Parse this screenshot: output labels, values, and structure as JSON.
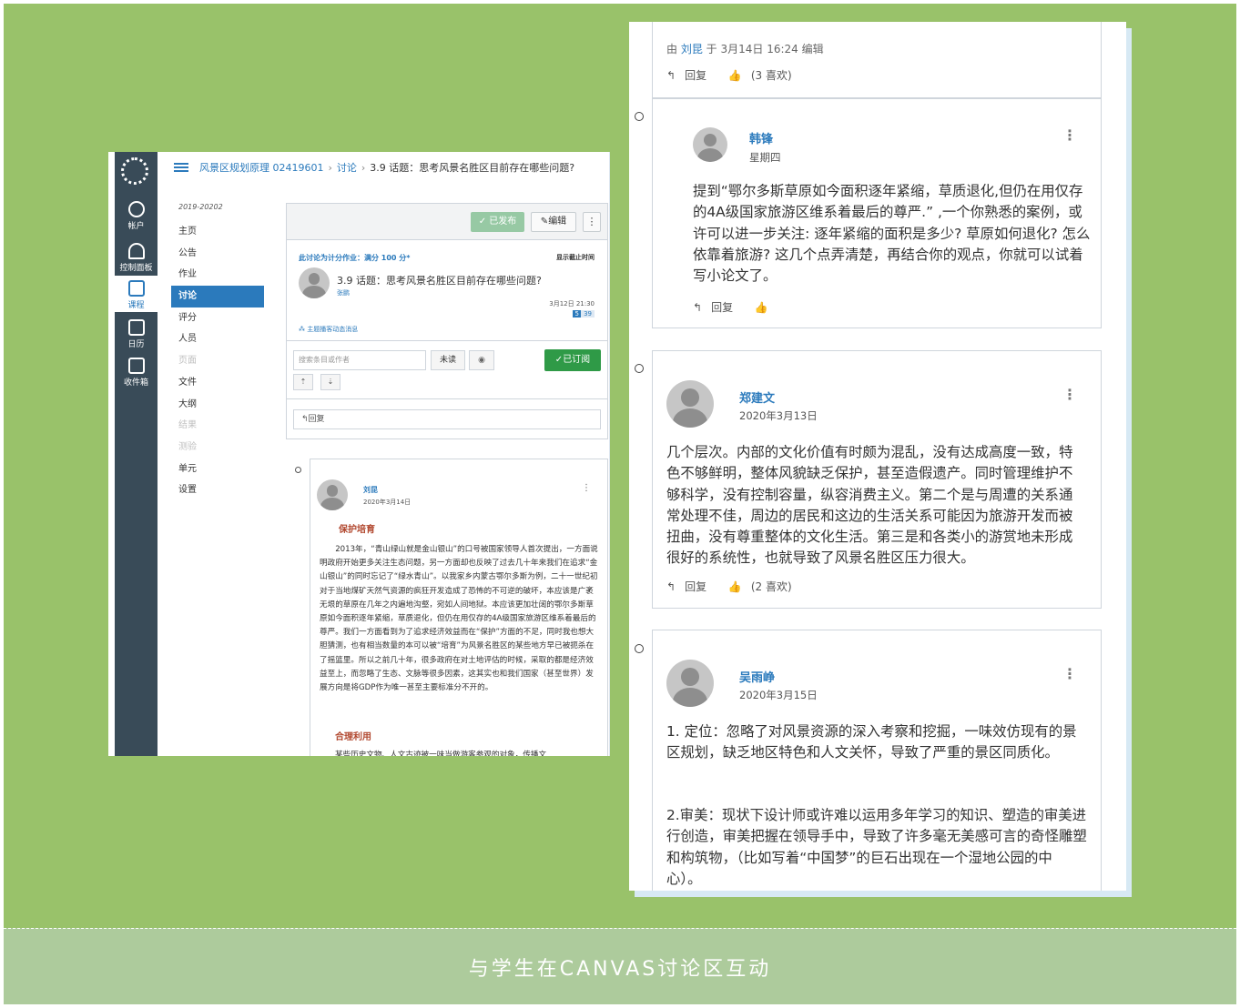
{
  "caption": "与学生在CANVAS讨论区互动",
  "left": {
    "global_nav": [
      {
        "label": "帐户",
        "icon": "account-icon"
      },
      {
        "label": "控制面板",
        "icon": "dashboard-icon"
      },
      {
        "label": "课程",
        "icon": "courses-icon"
      },
      {
        "label": "日历",
        "icon": "calendar-icon"
      },
      {
        "label": "收件箱",
        "icon": "inbox-icon"
      }
    ],
    "breadcrumb": {
      "course": "风景区规划原理 02419601",
      "section": "讨论",
      "current": "3.9 话题：思考风景名胜区目前存在哪些问题?"
    },
    "term": "2019-20202",
    "course_nav": [
      "主页",
      "公告",
      "作业",
      "讨论",
      "评分",
      "人员",
      "页面",
      "文件",
      "大纲",
      "结果",
      "测验",
      "单元",
      "设置"
    ],
    "topic": {
      "published_label": "已发布",
      "edit_label": "编辑",
      "kebab": "⋮",
      "graded_label": "此讨论为计分作业：满分 100 分*",
      "due_label": "显示截止时间",
      "title": "3.9 话题：思考风景名胜区目前存在哪些问题?",
      "author": "张鹏",
      "date": "3月12日 21:30",
      "unread_count": "5",
      "total_count": "39",
      "subscribe_hint": "主题播客动态消息"
    },
    "toolbar": {
      "search_placeholder": "搜索条目或作者",
      "unread_label": "未读",
      "eye": "◉",
      "subscribed_label": "已订阅",
      "expand": "⇡",
      "collapse": "⇣",
      "reply_label": "回复"
    },
    "entry": {
      "author": "刘昆",
      "date": "2020年3月14日",
      "kebab": "⋮",
      "heading1": "保护培育",
      "body": "2013年，“青山绿山就是金山银山”的口号被国家领导人首次提出，一方面说明政府开始更多关注生态问题，另一方面却也反映了过去几十年来我们在追求“金山银山”的同时忘记了“绿水青山”。以我家乡内蒙古鄂尔多斯为例，二十一世纪初对于当地煤矿天然气资源的疯狂开发造成了恐怖的不可逆的破坏，本应该是广袤无垠的草原在几年之内遍地沟壑，宛如人间地狱。本应该更加壮阔的鄂尔多斯草原如今面积逐年紧缩，草质退化，但仍在用仅存的4A级国家旅游区维系着最后的尊严。我们一方面看到为了追求经济效益而在“保护”方面的不足，同时我也想大胆猜测，也有相当数量的本可以被“培育”为风景名胜区的某些地方早已被扼杀在了摇篮里。所以之前几十年，很多政府在对土地评估的时候，采取的都是经济效益至上，而忽略了生态、文脉等很多因素，这其实也和我们国家（甚至世界）发展方向是将GDP作为唯一甚至主要标准分不开的。",
      "heading2": "合理利用",
      "tail": "某些历史文物、人文古迹被一味当做游客参观的对象，传播文"
    }
  },
  "right": {
    "top": {
      "edited_prefix": "由 ",
      "edited_by": "刘昆",
      "edited_suffix": " 于 3月14日 16:24 编辑",
      "reply": "回复",
      "likes": "(3 喜欢)"
    },
    "posts": [
      {
        "author": "韩锋",
        "date": "星期四",
        "text": "提到“鄂尔多斯草原如今面积逐年紧缩，草质退化,但仍在用仅存的4A级国家旅游区维系着最后的尊严.” ,一个你熟悉的案例，或许可以进一步关注: 逐年紧缩的面积是多少? 草原如何退化? 怎么依靠着旅游? 这几个点弄清楚，再结合你的观点，你就可以试着写小论文了。",
        "reply": "回复",
        "likes": ""
      },
      {
        "author": "郑建文",
        "date": "2020年3月13日",
        "text": "几个层次。内部的文化价值有时颇为混乱，没有达成高度一致，特色不够鲜明，整体风貌缺乏保护，甚至造假遗产。同时管理维护不够科学，没有控制容量，纵容消费主义。第二个是与周遭的关系通常处理不佳，周边的居民和这边的生活关系可能因为旅游开发而被扭曲，没有尊重整体的文化生活。第三是和各类小的游赏地未形成很好的系统性，也就导致了风景名胜区压力很大。",
        "reply": "回复",
        "likes": "(2 喜欢)"
      },
      {
        "author": "吴雨峥",
        "date": "2020年3月15日",
        "text1": "1. 定位：忽略了对风景资源的深入考察和挖掘，一味效仿现有的景区规划，缺乏地区特色和人文关怀，导致了严重的景区同质化。",
        "text2": "2.审美：现状下设计师或许难以运用多年学习的知识、塑造的审美进行创造，审美把握在领导手中，导致了许多毫无美感可言的奇怪雕塑和构筑物，（比如写着“中国梦”的巨石出现在一个湿地公园的中心）。"
      }
    ],
    "kebab": "⋮",
    "reply_icon": "↰",
    "like_icon": "👍"
  },
  "colors": {
    "background": "#99c26a",
    "caption_bar": "#adcb9c",
    "canvas_nav": "#394b58",
    "link_blue": "#2b7abc",
    "heading_red": "#b1472e",
    "subscribe_green": "#2f9a47"
  }
}
